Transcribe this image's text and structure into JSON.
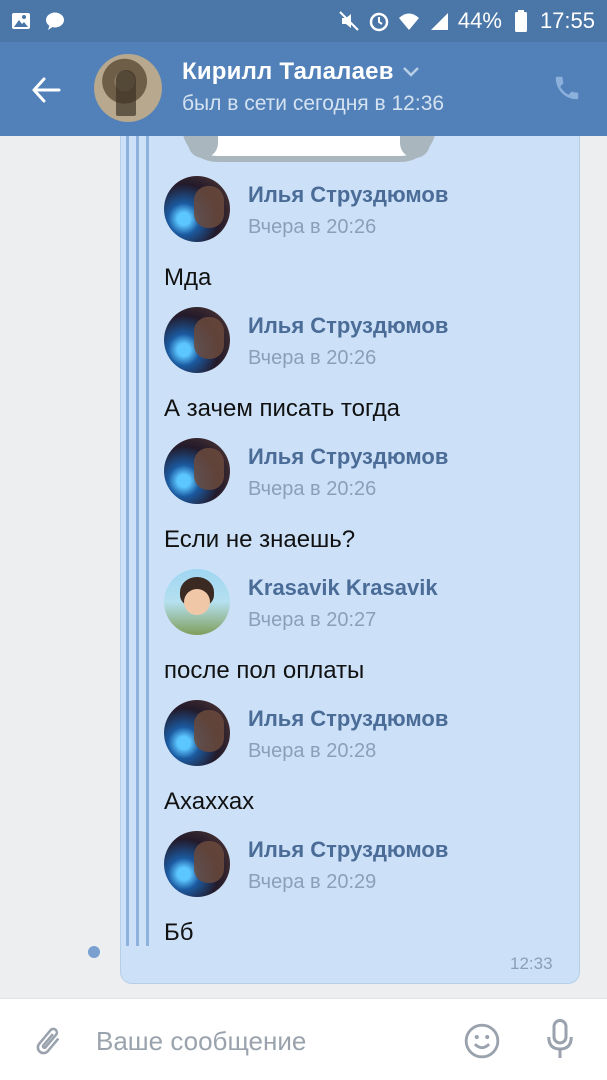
{
  "status_bar": {
    "battery": "44%",
    "time": "17:55",
    "icons": [
      "image-icon",
      "message-icon",
      "mute-icon",
      "alarm-icon",
      "wifi-icon",
      "signal-icon",
      "battery-icon"
    ]
  },
  "header": {
    "name": "Кирилл Талалаев",
    "status": "был в сети сегодня в 12:36",
    "icons": [
      "back-arrow-icon",
      "chevron-down-icon",
      "phone-icon"
    ],
    "accent": "#5181b8"
  },
  "messages": [
    {
      "author": "Илья Струздюмов",
      "time": "Вчера в 20:26",
      "text": "Мда"
    },
    {
      "author": "Илья Струздюмов",
      "time": "Вчера в 20:26",
      "text": "А зачем писать тогда"
    },
    {
      "author": "Илья Струздюмов",
      "time": "Вчера в 20:26",
      "text": "Если не знаешь?"
    },
    {
      "author": "Krasavik Krasavik",
      "time": "Вчера в 20:27",
      "text": "после пол оплаты"
    },
    {
      "author": "Илья Струздюмов",
      "time": "Вчера в 20:28",
      "text": "Ахаххах"
    },
    {
      "author": "Илья Струздюмов",
      "time": "Вчера в 20:29",
      "text": "Бб"
    }
  ],
  "bubble": {
    "time": "12:33",
    "background": "#cce1f8"
  },
  "composer": {
    "placeholder": "Ваше сообщение",
    "icons": [
      "attach-icon",
      "emoji-icon",
      "mic-icon"
    ]
  }
}
